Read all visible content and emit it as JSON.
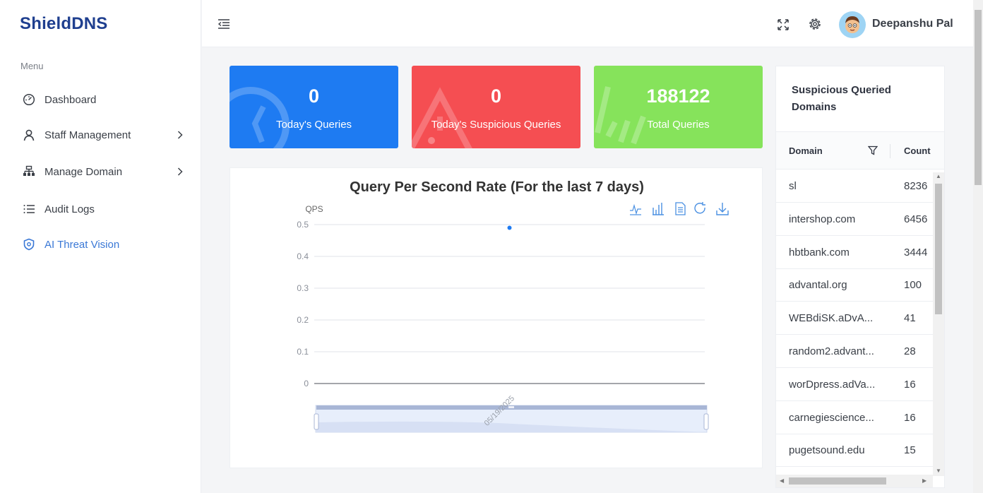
{
  "brand": "ShieldDNS",
  "sidebar": {
    "menu_title": "Menu",
    "items": [
      {
        "label": "Dashboard",
        "icon": "dashboard-gauge-icon"
      },
      {
        "label": "Staff Management",
        "icon": "user-icon",
        "has_children": true
      },
      {
        "label": "Manage Domain",
        "icon": "sitemap-icon",
        "has_children": true
      },
      {
        "label": "Audit Logs",
        "icon": "list-icon"
      },
      {
        "label": "AI Threat Vision",
        "icon": "shield-icon",
        "active": true
      }
    ]
  },
  "header": {
    "user_name": "Deepanshu Pal",
    "icons": [
      "menu-collapse-icon",
      "fullscreen-icon",
      "gear-icon",
      "avatar"
    ]
  },
  "stats": [
    {
      "value": "0",
      "caption": "Today's Queries",
      "color": "#1e7bf2"
    },
    {
      "value": "0",
      "caption": "Today's Suspicious Queries",
      "color": "#f54e52"
    },
    {
      "value": "188122",
      "caption": "Total Queries",
      "color": "#86e35b"
    }
  ],
  "chart": {
    "title": "Query Per Second Rate (For the last 7 days)",
    "toolbox": [
      "line-chart-icon",
      "bar-chart-icon",
      "data-view-icon",
      "restore-icon",
      "download-icon"
    ]
  },
  "chart_data": {
    "type": "scatter",
    "title": "Query Per Second Rate (For the last 7 days)",
    "ylabel": "QPS",
    "xlabel": "",
    "ylim": [
      0,
      0.5
    ],
    "yticks": [
      "0.5",
      "0.4",
      "0.3",
      "0.2",
      "0.1",
      "0"
    ],
    "x": [
      "05/19/2025"
    ],
    "series": [
      {
        "values": [
          0.49
        ]
      }
    ],
    "grid": true,
    "datazoom": true
  },
  "domains_table": {
    "title": "Suspicious Queried Domains",
    "columns": [
      "Domain",
      "Count"
    ],
    "rows": [
      {
        "domain": "sl",
        "count": "8236"
      },
      {
        "domain": "intershop.com",
        "count": "6456"
      },
      {
        "domain": "hbtbank.com",
        "count": "3444"
      },
      {
        "domain": "advantal.org",
        "count": "100"
      },
      {
        "domain": "WEBdiSK.aDvA...",
        "count": "41"
      },
      {
        "domain": "random2.advant...",
        "count": "28"
      },
      {
        "domain": "worDpress.adVa...",
        "count": "16"
      },
      {
        "domain": "carnegiescience...",
        "count": "16"
      },
      {
        "domain": "pugetsound.edu",
        "count": "15"
      }
    ]
  }
}
